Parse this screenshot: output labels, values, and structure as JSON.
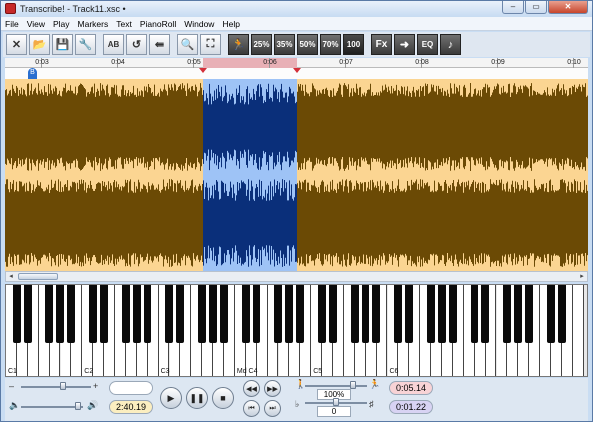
{
  "window": {
    "title": "Transcribe! - Track11.xsc •",
    "controls": {
      "minimize": "–",
      "maximize": "▭",
      "close": "✕"
    }
  },
  "menu": [
    "File",
    "View",
    "Play",
    "Markers",
    "Text",
    "PianoRoll",
    "Window",
    "Help"
  ],
  "toolbar": {
    "buttons": [
      {
        "name": "close-file-button",
        "glyph": "✕"
      },
      {
        "name": "open-file-button",
        "glyph": "📂"
      },
      {
        "name": "save-file-button",
        "glyph": "💾"
      },
      {
        "name": "tools-button",
        "glyph": "🔧"
      },
      {
        "name": "notation-button",
        "glyph": "AB"
      },
      {
        "name": "loop-button",
        "glyph": "↺"
      },
      {
        "name": "back-to-start-button",
        "glyph": "⇚"
      },
      {
        "name": "zoom-in-button",
        "glyph": "🔍"
      },
      {
        "name": "zoom-region-button",
        "glyph": "⛶"
      }
    ],
    "speed_icon": "🏃",
    "speeds": [
      "25%",
      "35%",
      "50%",
      "70%",
      "100"
    ],
    "fx_label": "Fx",
    "arrow_label": "➜",
    "eq_label": "EQ",
    "tuning_label": "♪"
  },
  "ruler": {
    "ticks": [
      "0:03",
      "0:04",
      "0:05",
      "0:06",
      "0:07",
      "0:08",
      "0:09",
      "0:10"
    ]
  },
  "markers": {
    "b_label": "B"
  },
  "piano": {
    "labels": [
      "C1",
      "C2",
      "C3",
      "Md C4",
      "C5",
      "C6"
    ]
  },
  "transport": {
    "position_display": "",
    "total_time": "2:40.19",
    "speed_percent": "100%",
    "pitch_value": "0",
    "loop_start": "0:05.14",
    "loop_end": "0:01.22",
    "vol_minus": "–",
    "vol_plus": "+"
  },
  "colors": {
    "wave_background": "#fbd592",
    "wave_fill": "#6b4a05",
    "selection_background": "#9ec3f6",
    "selection_wave": "#0a2f7a"
  }
}
